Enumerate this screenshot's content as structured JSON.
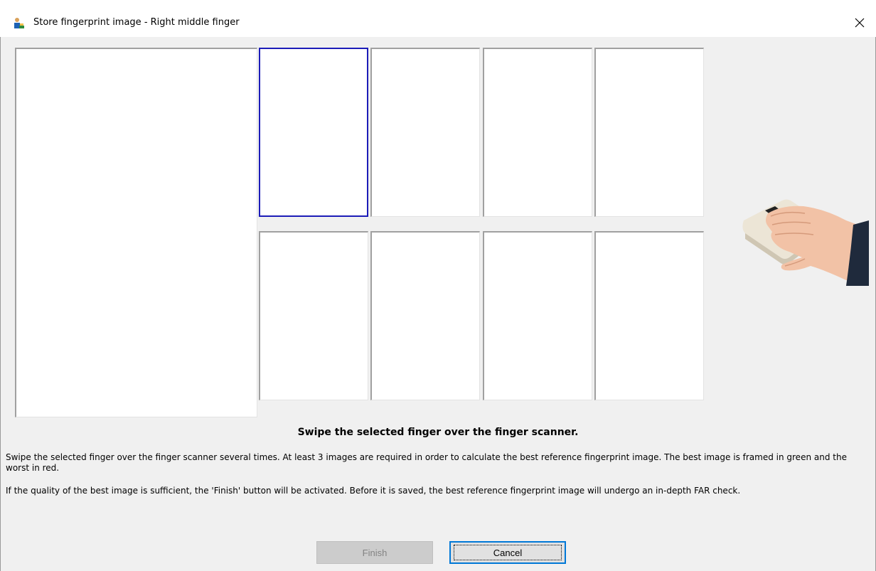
{
  "window": {
    "title": "Store fingerprint image - Right middle finger",
    "icon": "user-person-icon",
    "close_icon": "close-icon"
  },
  "capture": {
    "main_image_label": "",
    "thumbnails_count_visible": 8,
    "selected_thumbnail_index": 0,
    "selected_frame_color": "#1c1cb8"
  },
  "illustration": {
    "icon": "fingerprint-scanner-hand-icon"
  },
  "instructions": {
    "heading": "Swipe the selected finger over the finger scanner.",
    "paragraph1": "Swipe the selected finger over the finger scanner several times. At least 3 images are required in order to calculate the best reference fingerprint image. The best image is framed in green and the worst in red.",
    "paragraph2": "If the quality of the best image is sufficient, the 'Finish' button will be activated. Before it is saved, the best reference fingerprint image will undergo an in-depth FAR check."
  },
  "buttons": {
    "finish_label": "Finish",
    "finish_enabled": false,
    "cancel_label": "Cancel"
  }
}
